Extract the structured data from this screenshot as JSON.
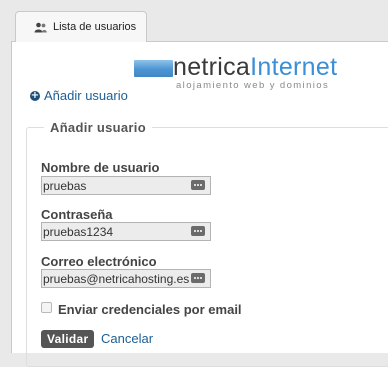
{
  "tab": {
    "label": "Lista de usuarios",
    "icon": "users-icon"
  },
  "logo": {
    "part1": "netrica",
    "part2": "Internet",
    "tagline": "alojamiento web y dominios"
  },
  "add_user_link": {
    "label": "Añadir usuario",
    "icon": "plus-circle-icon"
  },
  "form": {
    "legend": "Añadir usuario",
    "username": {
      "label": "Nombre de usuario",
      "value": "pruebas"
    },
    "password": {
      "label": "Contraseña",
      "value": "pruebas1234"
    },
    "email": {
      "label": "Correo electrónico",
      "value": "pruebas@netricahosting.es"
    },
    "send_credentials": {
      "label": "Enviar credenciales por email",
      "checked": false
    },
    "submit_label": "Validar",
    "cancel_label": "Cancelar"
  },
  "colors": {
    "link": "#1d5e95",
    "brand_blue": "#3a8fd6",
    "button_bg": "#555555"
  }
}
